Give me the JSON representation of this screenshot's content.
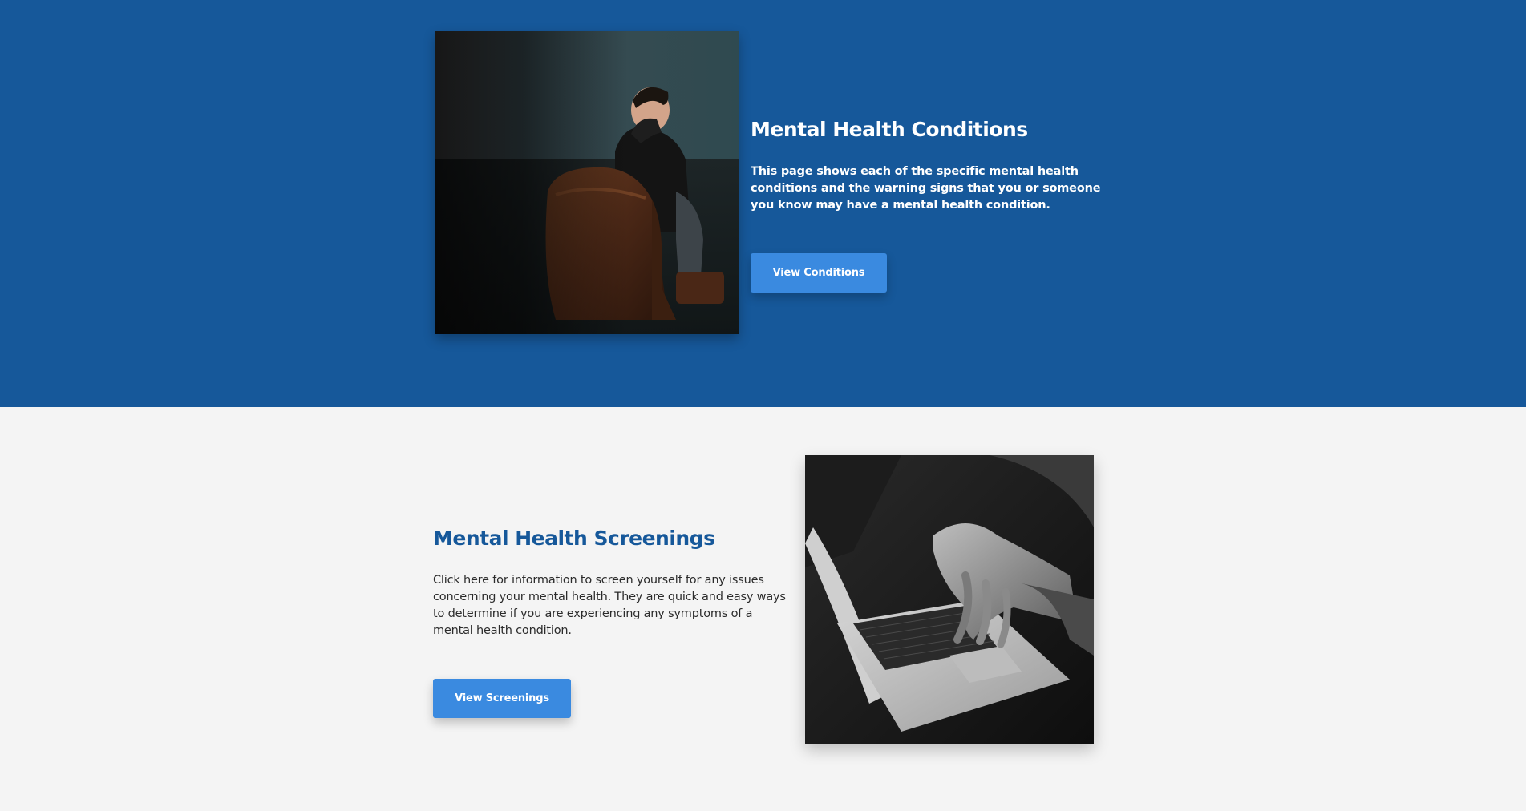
{
  "conditions": {
    "heading": "Mental Health Conditions",
    "body": "This page shows each of the specific mental health conditions and the warning signs that you or someone you know may have a mental health condition.",
    "button_label": "View Conditions",
    "image": "man-in-armchair-photo"
  },
  "screenings": {
    "heading": "Mental Health Screenings",
    "body": "Click here for information to screen yourself for any issues concerning your mental health. They are quick and easy ways to determine if you are experiencing any symptoms of a mental health condition.",
    "button_label": "View Screenings",
    "image": "hands-on-laptop-photo"
  },
  "colors": {
    "top_section_bg": "#16589a",
    "bottom_section_bg": "#f4f4f4",
    "button_bg": "#3a8ae0",
    "heading_accent": "#16589a"
  }
}
